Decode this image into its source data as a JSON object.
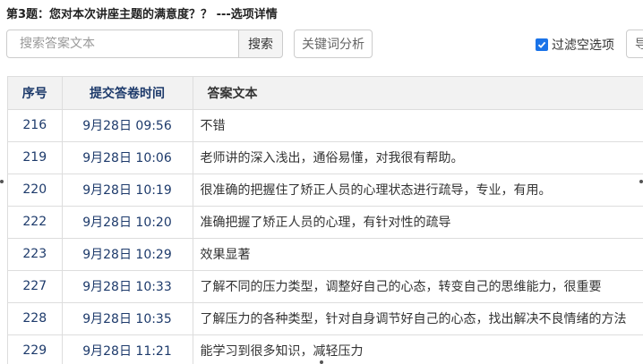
{
  "header": {
    "title": "第3题：您对本次讲座主题的满意度？？ ---选项详情"
  },
  "toolbar": {
    "search_placeholder": "搜索答案文本",
    "search_label": "搜索",
    "keyword_label": "关键词分析",
    "filter_label": "过滤空选项",
    "filter_checked": true,
    "export_label": "导出"
  },
  "table": {
    "columns": [
      "序号",
      "提交答卷时间",
      "答案文本"
    ],
    "rows": [
      {
        "id": "216",
        "time": "9月28日 09:56",
        "text": "不错"
      },
      {
        "id": "219",
        "time": "9月28日 10:06",
        "text": "老师讲的深入浅出，通俗易懂，对我很有帮助。"
      },
      {
        "id": "220",
        "time": "9月28日 10:19",
        "text": "很准确的把握住了矫正人员的心理状态进行疏导，专业，有用。"
      },
      {
        "id": "222",
        "time": "9月28日 10:20",
        "text": "准确把握了矫正人员的心理，有针对性的疏导"
      },
      {
        "id": "223",
        "time": "9月28日 10:29",
        "text": "效果显著"
      },
      {
        "id": "227",
        "time": "9月28日 10:33",
        "text": "了解不同的压力类型，调整好自己的心态，转变自己的思维能力，很重要"
      },
      {
        "id": "228",
        "time": "9月28日 10:35",
        "text": "了解压力的各种类型，针对自身调节好自己的心态，找出解决不良情绪的方法"
      },
      {
        "id": "229",
        "time": "9月28日 11:21",
        "text": "能学习到很多知识，减轻压力"
      }
    ]
  }
}
